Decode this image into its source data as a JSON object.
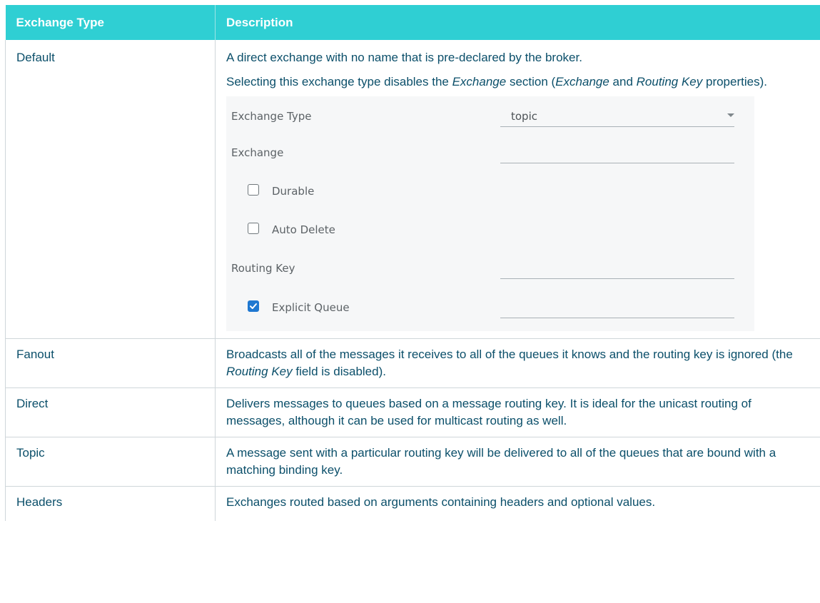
{
  "table": {
    "headers": [
      "Exchange Type",
      "Description"
    ],
    "rows": [
      {
        "type": "Default",
        "desc_p1": "A direct exchange with no name that is pre-declared by the broker.",
        "desc_p2_a": "Selecting this exchange type disables the ",
        "desc_p2_em1": "Exchange",
        "desc_p2_b": " section (",
        "desc_p2_em2": "Exchange",
        "desc_p2_c": " and ",
        "desc_p2_em3": "Routing Key",
        "desc_p2_d": " properties)."
      },
      {
        "type": "Fanout",
        "desc_a": "Broadcasts all of the messages it receives to all of the queues it knows and the routing key is ignored (the ",
        "desc_em": "Routing Key",
        "desc_b": " field is disabled)."
      },
      {
        "type": "Direct",
        "desc": "Delivers messages to queues based on a message routing key. It is ideal for the unicast routing of messages, although it can be used for multicast routing as well."
      },
      {
        "type": "Topic",
        "desc": "A message sent with a particular routing key will be delivered to all of the queues that are bound with a matching binding key."
      },
      {
        "type": "Headers",
        "desc": "Exchanges routed based on arguments containing headers and optional values."
      }
    ]
  },
  "panel": {
    "exchange_type_label": "Exchange Type",
    "exchange_type_value": "topic",
    "exchange_label": "Exchange",
    "exchange_value": "",
    "durable_label": "Durable",
    "durable_checked": false,
    "auto_delete_label": "Auto Delete",
    "auto_delete_checked": false,
    "routing_key_label": "Routing Key",
    "routing_key_value": "",
    "explicit_queue_label": "Explicit Queue",
    "explicit_queue_checked": true,
    "explicit_queue_value": ""
  },
  "colors": {
    "header_bg": "#2fcfd3",
    "header_text": "#ffffff",
    "body_text": "#0b4f6a",
    "border": "#cfd6da",
    "checkbox_checked": "#1f78d1"
  }
}
